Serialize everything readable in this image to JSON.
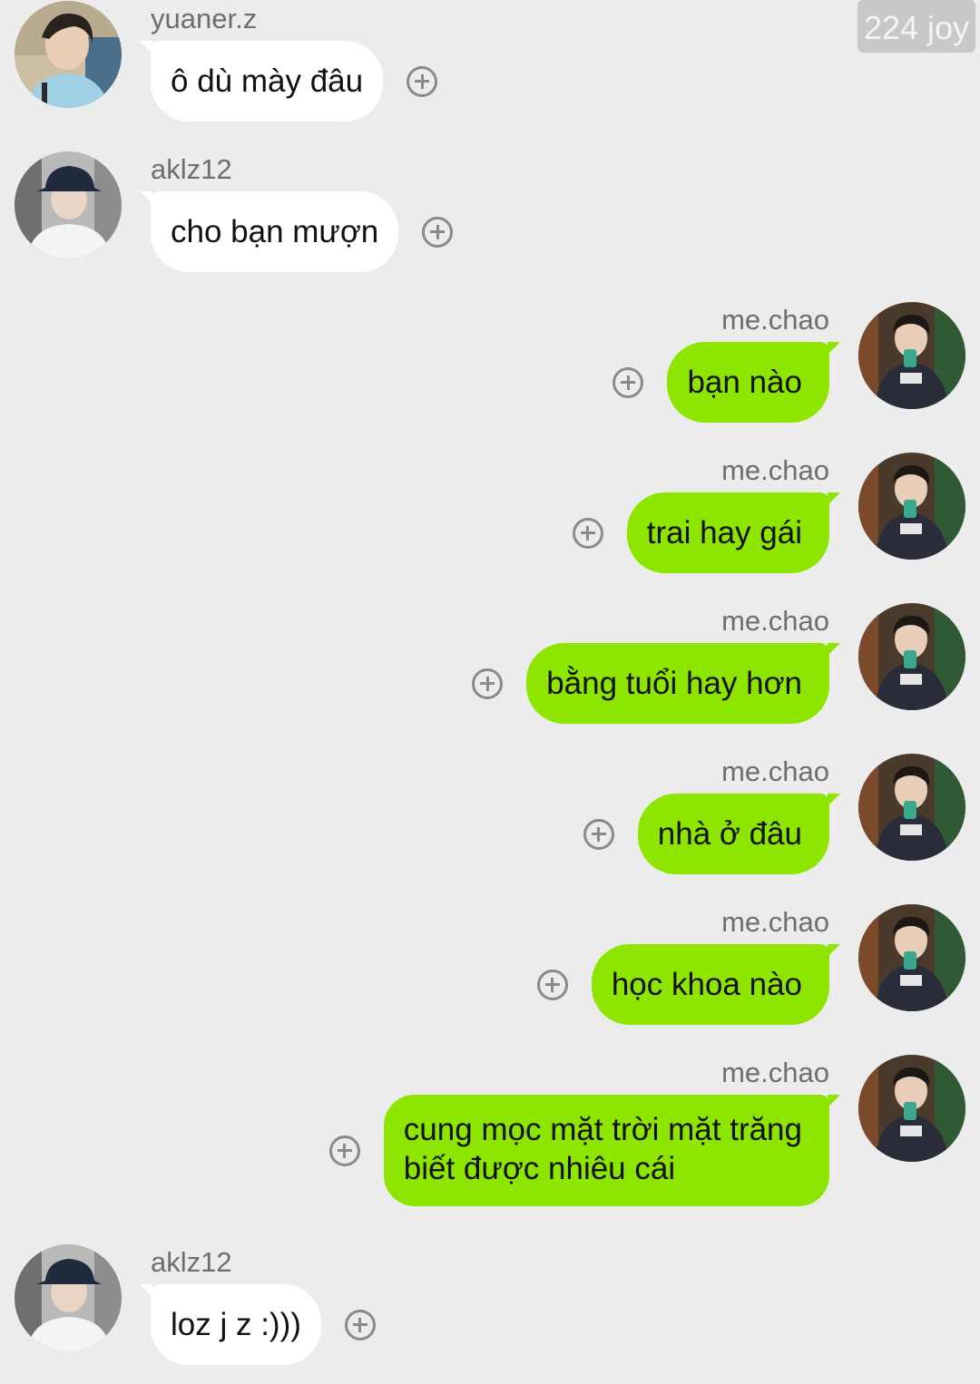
{
  "watermark": "224 joy",
  "colors": {
    "background": "#ececec",
    "incoming_bubble": "#ffffff",
    "outgoing_bubble": "#8ee600",
    "username": "#6e6e6e",
    "plus_icon": "#8a8a8a"
  },
  "messages": [
    {
      "side": "left",
      "avatar": "avatar-yuaner",
      "name": "yuaner.z",
      "text": "ô dù mày đâu"
    },
    {
      "side": "left",
      "avatar": "avatar-aklz",
      "name": "aklz12",
      "text": "cho bạn mượn"
    },
    {
      "side": "right",
      "avatar": "avatar-me",
      "name": "me.chao",
      "text": "bạn nào"
    },
    {
      "side": "right",
      "avatar": "avatar-me",
      "name": "me.chao",
      "text": "trai hay gái"
    },
    {
      "side": "right",
      "avatar": "avatar-me",
      "name": "me.chao",
      "text": "bằng tuổi hay hơn"
    },
    {
      "side": "right",
      "avatar": "avatar-me",
      "name": "me.chao",
      "text": "nhà ở đâu"
    },
    {
      "side": "right",
      "avatar": "avatar-me",
      "name": "me.chao",
      "text": "học khoa nào"
    },
    {
      "side": "right",
      "avatar": "avatar-me",
      "name": "me.chao",
      "text": "cung mọc mặt trời mặt trăng\nbiết được nhiêu cái"
    },
    {
      "side": "left",
      "avatar": "avatar-aklz",
      "name": "aklz12",
      "text": "loz j z :)))"
    }
  ]
}
